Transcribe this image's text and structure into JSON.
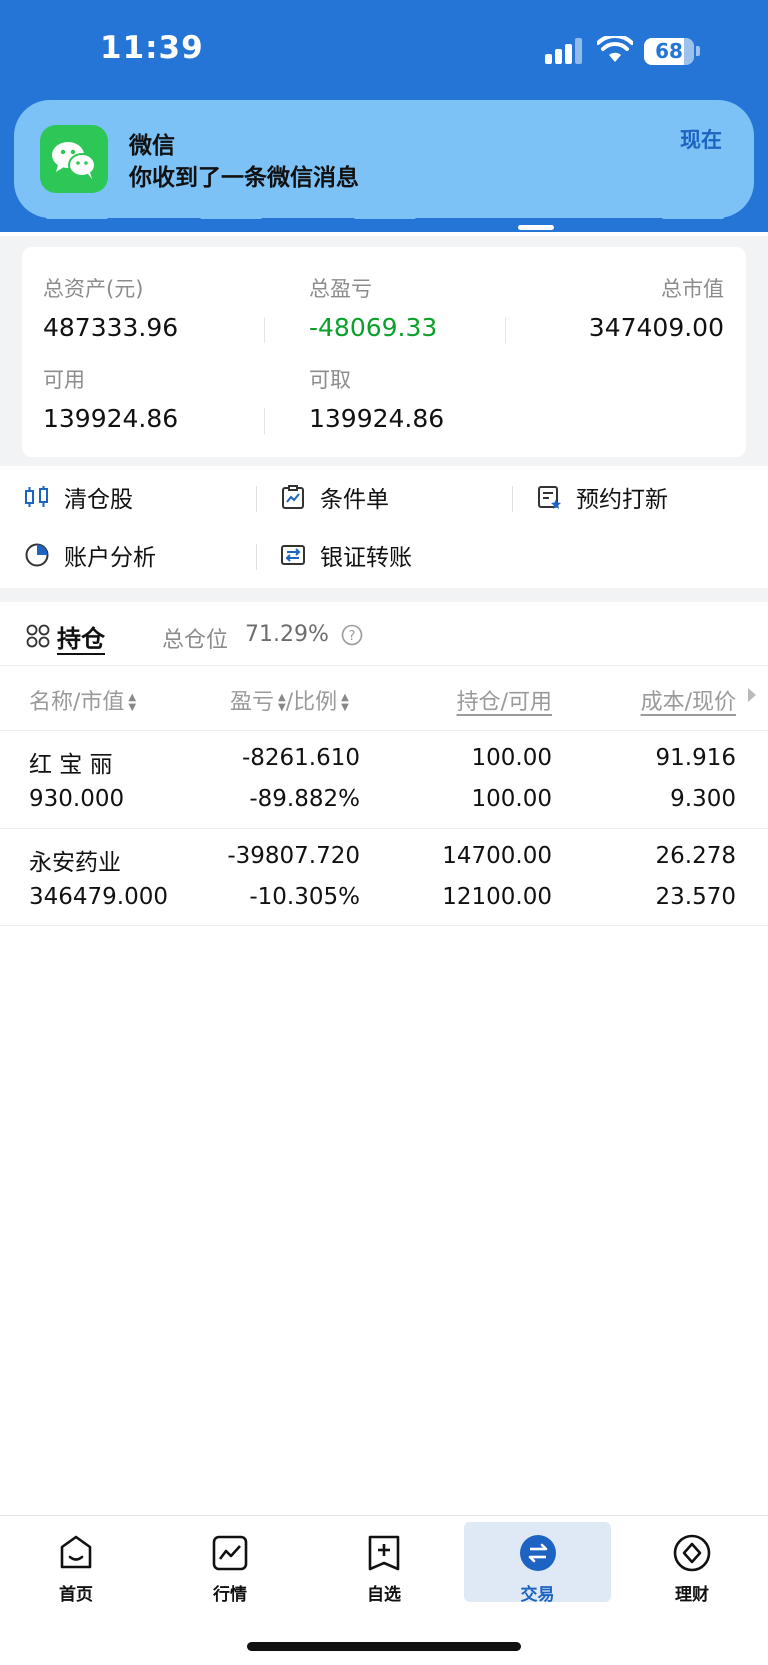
{
  "status_bar": {
    "time": "11:39",
    "battery": "68"
  },
  "notification": {
    "app": "微信",
    "message": "你收到了一条微信消息",
    "time": "现在"
  },
  "account": {
    "total_assets_label": "总资产(元)",
    "total_assets": "487333.96",
    "total_pl_label": "总盈亏",
    "total_pl": "-48069.33",
    "market_value_label": "总市值",
    "market_value": "347409.00",
    "available_label": "可用",
    "available": "139924.86",
    "withdrawable_label": "可取",
    "withdrawable": "139924.86"
  },
  "actions": [
    {
      "label": "清仓股",
      "icon": "candlestick-icon"
    },
    {
      "label": "条件单",
      "icon": "clipboard-chart-icon"
    },
    {
      "label": "预约打新",
      "icon": "reservation-icon"
    },
    {
      "label": "账户分析",
      "icon": "pie-chart-icon"
    },
    {
      "label": "银证转账",
      "icon": "transfer-icon"
    }
  ],
  "holdings": {
    "title": "持仓",
    "position_label": "总仓位",
    "position_value": "71.29%",
    "columns": {
      "name": "名称/市值",
      "pl": "盈亏",
      "ratio": "/比例",
      "qty": "持仓/可用",
      "cost": "成本/现价"
    },
    "rows": [
      {
        "name": "红 宝 丽",
        "value": "930.000",
        "pl": "-8261.610",
        "ratio": "-89.882%",
        "qty": "100.00",
        "avail": "100.00",
        "cost": "91.916",
        "price": "9.300"
      },
      {
        "name": "永安药业",
        "value": "346479.000",
        "pl": "-39807.720",
        "ratio": "-10.305%",
        "qty": "14700.00",
        "avail": "12100.00",
        "cost": "26.278",
        "price": "23.570"
      }
    ]
  },
  "nav": [
    {
      "label": "首页",
      "icon": "home-icon"
    },
    {
      "label": "行情",
      "icon": "chart-icon"
    },
    {
      "label": "自选",
      "icon": "bookmark-add-icon"
    },
    {
      "label": "交易",
      "icon": "trade-icon",
      "active": true
    },
    {
      "label": "理财",
      "icon": "wealth-icon"
    }
  ],
  "colors": {
    "brand": "#2575d6",
    "loss": "#0aa12a",
    "accent": "#1d64c2"
  }
}
